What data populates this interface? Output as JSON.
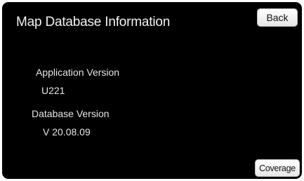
{
  "header": {
    "title": "Map Database Information",
    "back_label": "Back"
  },
  "info": {
    "application_version_label": "Application Version",
    "application_version_value": "U221",
    "database_version_label": "Database Version",
    "database_version_value": "V 20.08.09"
  },
  "footer": {
    "coverage_label": "Coverage"
  },
  "colors": {
    "background": "#000000",
    "text": "#e6e6e6",
    "button_bg": "#ffffff",
    "button_text": "#111111"
  }
}
